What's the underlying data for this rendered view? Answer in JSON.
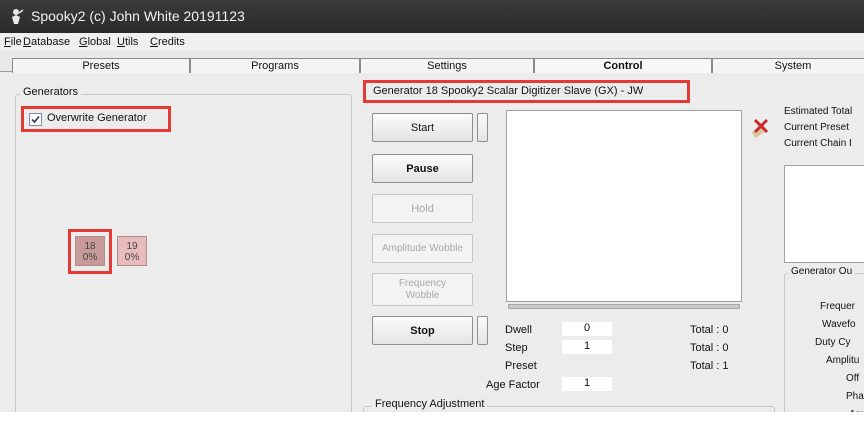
{
  "window": {
    "title": "Spooky2 (c) John White 20191123"
  },
  "menu": [
    "File",
    "Database",
    "Global",
    "Utils",
    "Credits"
  ],
  "tabs": [
    "Presets",
    "Programs",
    "Settings",
    "Control",
    "System"
  ],
  "active_tab": "Control",
  "generators_panel": {
    "legend": "Generators",
    "overwrite_label": "Overwrite Generator",
    "overwrite_checked": true,
    "tiles": [
      {
        "num": "18",
        "pct": "0%",
        "selected": true
      },
      {
        "num": "19",
        "pct": "0%",
        "selected": false
      }
    ]
  },
  "control": {
    "generator_header": "Generator 18    Spooky2 Scalar Digitizer Slave (GX) - JW",
    "buttons": {
      "start": "Start",
      "pause": "Pause",
      "hold": "Hold",
      "amplitude_wobble": "Amplitude Wobble",
      "frequency_wobble": "Frequency Wobble",
      "stop": "Stop"
    },
    "stats": {
      "dwell_label": "Dwell",
      "dwell_value": "0",
      "dwell_total": "Total : 0",
      "step_label": "Step",
      "step_value": "1",
      "step_total": "Total : 0",
      "preset_label": "Preset",
      "preset_total": "Total : 1",
      "age_label": "Age Factor",
      "age_value": "1"
    },
    "freq_adjustment_label": "Frequency Adjustment"
  },
  "right_panel": {
    "estimated_total": "Estimated Total",
    "current_preset": "Current Preset",
    "current_chain": "Current Chain I",
    "generator_output": "Generator Ou",
    "rows": [
      "Frequer",
      "Wavefo",
      "Duty Cy",
      "Amplitu",
      "Off",
      "Pha",
      "Am"
    ]
  },
  "colors": {
    "highlight_red": "#e53935",
    "title_bg": "#2e2e2e",
    "tile_selected": "#c89a9a",
    "tile_normal": "#e8bcbc"
  }
}
